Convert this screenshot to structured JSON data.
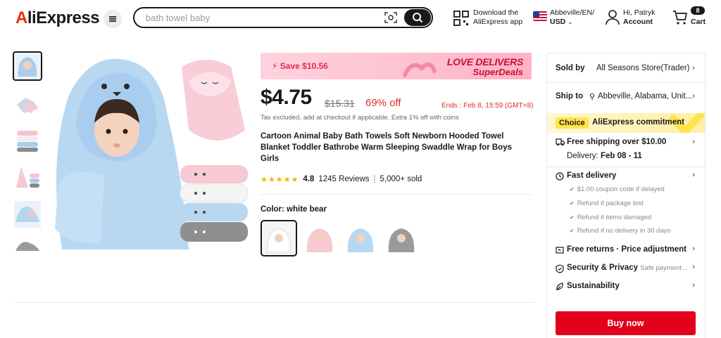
{
  "header": {
    "logo": "AliExpress",
    "search_placeholder": "bath towel baby",
    "download_line1": "Download the",
    "download_line2": "AliExpress app",
    "locale_line1": "Abbeville/EN/",
    "locale_line2": "USD",
    "account_line1": "Hi, Patryk",
    "account_line2": "Account",
    "cart_count": "8",
    "cart_label": "Cart"
  },
  "gallery": {
    "thumbnails": [
      "white bear hooded towel",
      "towel stack",
      "towel stack grey",
      "pink towels",
      "blue towels",
      "grey towel"
    ],
    "active_index": 0
  },
  "product": {
    "banner_save": "Save $10.56",
    "banner_title1": "LOVE DELIVERS",
    "banner_title2": "SuperDeals",
    "price": "$4.75",
    "original_price": "$15.31",
    "discount": "69% off",
    "ends": "Ends : Feb 8, 15:59 (GMT+8)",
    "tax_note": "Tax excluded, add at checkout if applicable. Extra 1% off with coins",
    "title": "Cartoon Animal Baby Bath Towels Soft Newborn Hooded Towel Blanket Toddler Bathrobe Warm Sleeping Swaddle Wrap for Boys Girls",
    "stars": "★★★★★",
    "rating": "4.8",
    "reviews": "1245 Reviews",
    "sold": "5,000+ sold",
    "color_label": "Color: white bear",
    "swatches": [
      "white bear",
      "pink cat",
      "blue bear",
      "grey elephant"
    ],
    "selected_swatch": 0
  },
  "panel": {
    "sold_by_label": "Sold by",
    "sold_by_value": "All Seasons Store(Trader)",
    "ship_to_label": "Ship to",
    "ship_to_value": "Abbeville, Alabama, Unit...",
    "choice_badge": "Choice",
    "choice_text": "AliExpress commitment",
    "free_shipping": "Free shipping over $10.00",
    "delivery_label": "Delivery:",
    "delivery_value": "Feb 08 - 11",
    "fast_delivery": "Fast delivery",
    "bullets": [
      "$1.00 coupon code if delayed",
      "Refund if package lost",
      "Refund if items damaged",
      "Refund if no delivery in 30 days"
    ],
    "free_returns": "Free returns · Price adjustment",
    "security": "Security & Privacy",
    "security_note": "Safe payment...",
    "sustainability": "Sustainability",
    "buy_now": "Buy now"
  },
  "colors": {
    "accent_red": "#e3001b",
    "price_red": "#e02c2c",
    "choice_yellow": "#ffe44a",
    "star_yellow": "#f5b400"
  }
}
